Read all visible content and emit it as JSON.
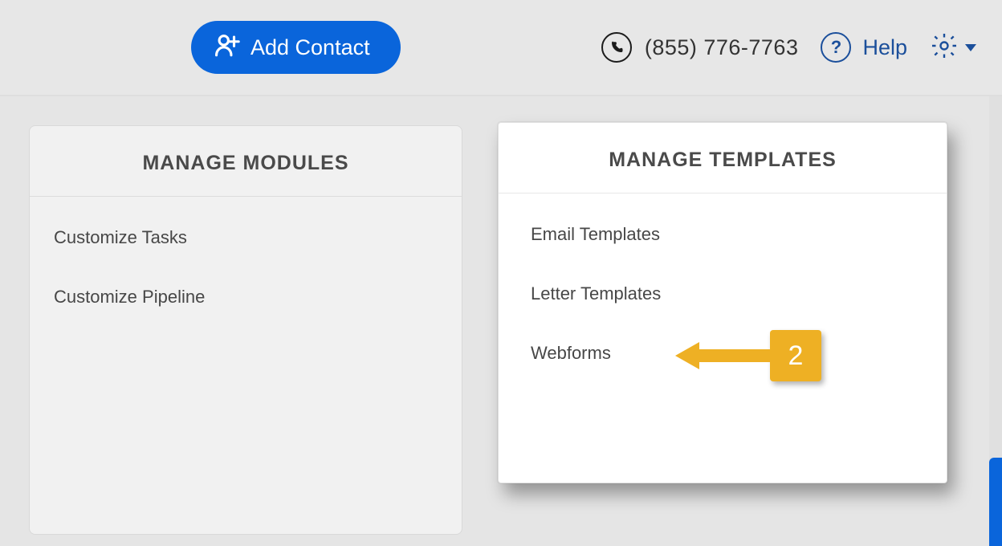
{
  "topbar": {
    "add_contact_label": "Add Contact",
    "phone_number": "(855) 776-7763",
    "help_label": "Help"
  },
  "modules_card": {
    "title": "MANAGE MODULES",
    "items": [
      "Customize Tasks",
      "Customize Pipeline"
    ]
  },
  "templates_card": {
    "title": "MANAGE TEMPLATES",
    "items": [
      "Email Templates",
      "Letter Templates",
      "Webforms"
    ]
  },
  "annotation": {
    "step": "2"
  }
}
